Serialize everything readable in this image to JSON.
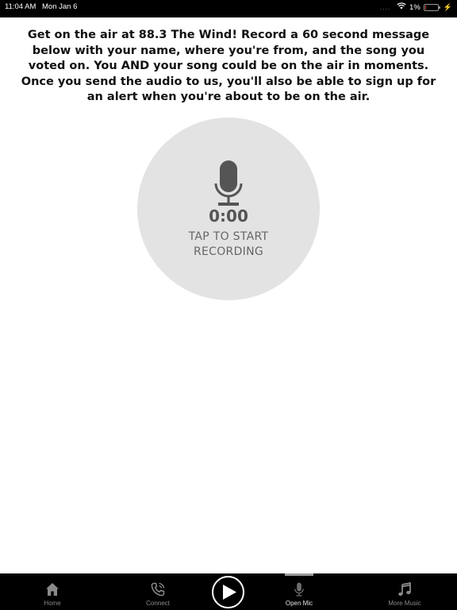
{
  "status_bar": {
    "time": "11:04 AM",
    "date": "Mon Jan 6",
    "signal": "....",
    "battery": "1%",
    "battery_level": 0.01,
    "icons": [
      "wifi-icon",
      "battery-icon",
      "charging-icon"
    ]
  },
  "intro": {
    "text": "Get on the air at 88.3 The Wind! Record a 60 second message below with your name, where you're from, and the song you voted on. You AND your song could be on the air in moments. Once you send the audio to us, you'll also be able to sign up for an alert when you're about to be on the air."
  },
  "recorder": {
    "icon": "microphone-icon",
    "timer": "0:00",
    "label": "TAP TO START RECORDING"
  },
  "tab_bar": {
    "tabs": [
      {
        "label": "Home",
        "icon": "home-icon"
      },
      {
        "label": "Connect",
        "icon": "phone-icon"
      },
      {
        "label": "",
        "icon": "play-icon"
      },
      {
        "label": "Open Mic",
        "icon": "microphone-icon",
        "active": true
      },
      {
        "label": "More Music",
        "icon": "music-note-icon"
      }
    ]
  },
  "colors": {
    "bar_background": "#000000",
    "circle_background": "#e3e3e3",
    "icon_gray": "#555555",
    "inactive_tab": "#8a8a8a",
    "battery_red": "#ff3b30"
  }
}
